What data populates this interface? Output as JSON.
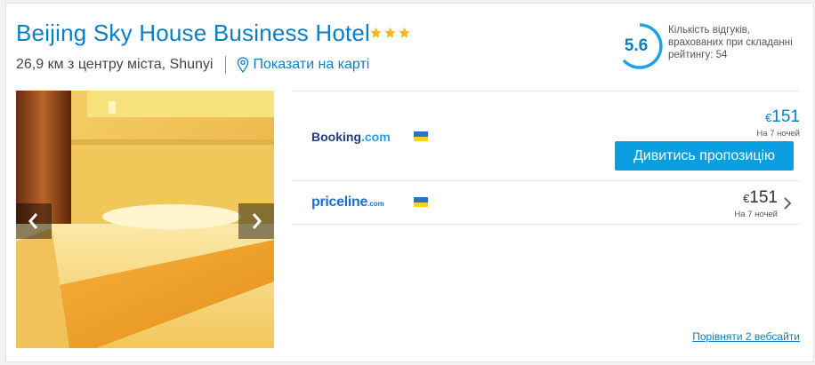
{
  "hotel": {
    "name": "Beijing Sky House Business Hotel",
    "stars": 3,
    "distance_text": "26,9 км з центру міста, Shunyi",
    "map_link": "Показати на карті"
  },
  "rating": {
    "value": "5.6",
    "description": "Кількість відгуків, врахованих при складанні рейтингу: 54"
  },
  "offers": [
    {
      "provider_part1": "Booking",
      "provider_part2": ".com",
      "currency": "€",
      "price": "151",
      "nights": "На 7 ночей",
      "cta": "Дивитись пропозицію"
    },
    {
      "provider_part1": "priceline",
      "provider_part2": ".com",
      "currency": "€",
      "price": "151",
      "nights": "На 7 ночей"
    }
  ],
  "compare_link": "Порівняти 2 вебсайти",
  "colors": {
    "accent": "#0a7fc4",
    "button": "#0a9ee0",
    "star": "#f2b90f",
    "ring": "#1fa3e0"
  }
}
